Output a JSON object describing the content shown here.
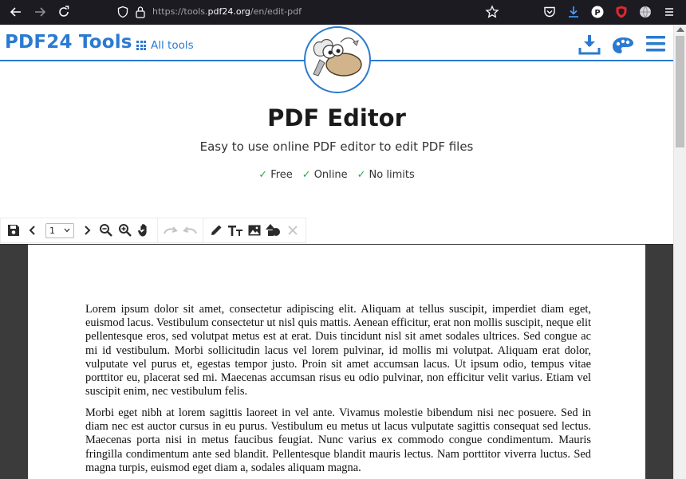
{
  "browser": {
    "url_prefix": "https://tools.",
    "url_host": "pdf24.org",
    "url_suffix": "/en/edit-pdf"
  },
  "header": {
    "brand": "PDF24 Tools",
    "all_tools_label": "All tools"
  },
  "hero": {
    "title": "PDF Editor",
    "subtitle": "Easy to use online PDF editor to edit PDF files",
    "features": [
      "Free",
      "Online",
      "No limits"
    ]
  },
  "toolbar": {
    "page_value": "1"
  },
  "document": {
    "paragraphs": [
      "Lorem ipsum dolor sit amet, consectetur adipiscing elit. Aliquam at tellus suscipit, imperdiet diam eget, euismod lacus. Vestibulum consectetur ut nisl quis mattis. Aenean efficitur, erat non mollis suscipit, neque elit pellentesque eros, sed volutpat metus est at erat. Duis tincidunt nisl sit amet sodales ultrices. Sed congue ac mi id vestibulum. Morbi sollicitudin lacus vel lorem pulvinar, id mollis mi volutpat. Aliquam erat dolor, vulputate vel purus et, egestas tempor justo. Proin sit amet accumsan lacus. Ut ipsum odio, tempus vitae porttitor eu, placerat sed mi. Maecenas accumsan risus eu odio pulvinar, non efficitur velit varius. Etiam vel suscipit enim, nec vestibulum felis.",
      "Morbi eget nibh at lorem sagittis laoreet in vel ante. Vivamus molestie bibendum nisi nec posuere. Sed in diam nec est auctor cursus in eu purus. Vestibulum eu metus ut lacus vulputate sagittis consequat sed lectus. Maecenas porta nisi in metus faucibus feugiat. Nunc varius ex commodo congue condimentum. Mauris fringilla condimentum ante sed blandit. Pellentesque blandit mauris lectus. Nam porttitor viverra luctus. Sed magna turpis, euismod eget diam a, sodales aliquam magna."
    ]
  },
  "colors": {
    "brand_blue": "#2a7ad1",
    "check_green": "#2ea44f",
    "chrome_bg": "#1c1b22",
    "editor_bg": "#3b3b3b"
  },
  "icons": [
    "back-arrow-icon",
    "forward-arrow-icon",
    "reload-icon",
    "shield-icon",
    "lock-icon",
    "bookmark-star-icon",
    "pocket-icon",
    "download-icon",
    "extension-p-icon",
    "shield-extension-icon",
    "globe-icon",
    "hamburger-menu-icon",
    "save-icon",
    "chevron-left-icon",
    "chevron-right-icon",
    "zoom-out-icon",
    "zoom-in-icon",
    "hand-icon",
    "redo-icon",
    "undo-icon",
    "pencil-icon",
    "text-icon",
    "image-icon",
    "shapes-icon",
    "close-icon"
  ]
}
